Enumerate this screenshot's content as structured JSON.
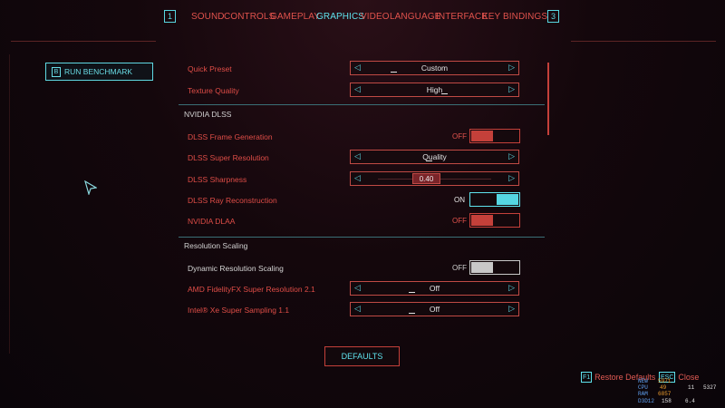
{
  "tabs": {
    "left_key": "1",
    "right_key": "3",
    "items": [
      "SOUND",
      "CONTROLS",
      "GAMEPLAY",
      "GRAPHICS",
      "VIDEO",
      "LANGUAGE",
      "INTERFACE",
      "KEY BINDINGS"
    ],
    "active": "GRAPHICS"
  },
  "benchmark": {
    "key": "B",
    "label": "RUN BENCHMARK"
  },
  "settings": {
    "quick_preset": {
      "label": "Quick Preset",
      "value": "Custom"
    },
    "texture_quality": {
      "label": "Texture Quality",
      "value": "High"
    },
    "section_dlss": "NVIDIA DLSS",
    "dlss_frame_gen": {
      "label": "DLSS Frame Generation",
      "state": "OFF"
    },
    "dlss_super_res": {
      "label": "DLSS Super Resolution",
      "value": "Quality"
    },
    "dlss_sharpness": {
      "label": "DLSS Sharpness",
      "value": "0.40"
    },
    "dlss_ray_recon": {
      "label": "DLSS Ray Reconstruction",
      "state": "ON"
    },
    "nvidia_dlaa": {
      "label": "NVIDIA DLAA",
      "state": "OFF"
    },
    "section_resolution": "Resolution Scaling",
    "dynamic_res": {
      "label": "Dynamic Resolution Scaling",
      "state": "OFF"
    },
    "amd_fsr": {
      "label": "AMD FidelityFX Super Resolution 2.1",
      "value": "Off"
    },
    "intel_xess": {
      "label": "Intel® Xe Super Sampling 1.1",
      "value": "Off"
    }
  },
  "defaults_button": "DEFAULTS",
  "hints": {
    "restore": {
      "key": "F1",
      "label": "Restore Defaults"
    },
    "close": {
      "key": "ESC",
      "label": "Close"
    }
  },
  "overlay": {
    "rows": [
      {
        "label": "NEW",
        "v1": "5971",
        "v2": "",
        "v3": ""
      },
      {
        "label": "CPU",
        "v1": "49",
        "v2": "11",
        "v3": "5327"
      },
      {
        "label": "RAM",
        "v1": "6857",
        "v2": "",
        "v3": ""
      },
      {
        "label": "D3D12",
        "v1": "158",
        "v2": "6.4",
        "v3": ""
      }
    ]
  },
  "colors": {
    "accent_red": "#e0524c",
    "accent_cyan": "#5fe3ee"
  }
}
